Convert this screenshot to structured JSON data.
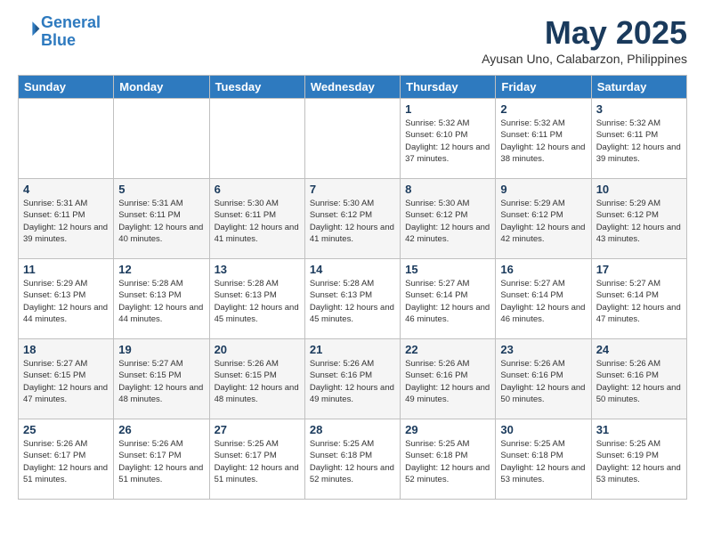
{
  "header": {
    "logo_line1": "General",
    "logo_line2": "Blue",
    "month": "May 2025",
    "location": "Ayusan Uno, Calabarzon, Philippines"
  },
  "days_of_week": [
    "Sunday",
    "Monday",
    "Tuesday",
    "Wednesday",
    "Thursday",
    "Friday",
    "Saturday"
  ],
  "weeks": [
    [
      {
        "day": "",
        "info": ""
      },
      {
        "day": "",
        "info": ""
      },
      {
        "day": "",
        "info": ""
      },
      {
        "day": "",
        "info": ""
      },
      {
        "day": "1",
        "info": "Sunrise: 5:32 AM\nSunset: 6:10 PM\nDaylight: 12 hours\nand 37 minutes."
      },
      {
        "day": "2",
        "info": "Sunrise: 5:32 AM\nSunset: 6:11 PM\nDaylight: 12 hours\nand 38 minutes."
      },
      {
        "day": "3",
        "info": "Sunrise: 5:32 AM\nSunset: 6:11 PM\nDaylight: 12 hours\nand 39 minutes."
      }
    ],
    [
      {
        "day": "4",
        "info": "Sunrise: 5:31 AM\nSunset: 6:11 PM\nDaylight: 12 hours\nand 39 minutes."
      },
      {
        "day": "5",
        "info": "Sunrise: 5:31 AM\nSunset: 6:11 PM\nDaylight: 12 hours\nand 40 minutes."
      },
      {
        "day": "6",
        "info": "Sunrise: 5:30 AM\nSunset: 6:11 PM\nDaylight: 12 hours\nand 41 minutes."
      },
      {
        "day": "7",
        "info": "Sunrise: 5:30 AM\nSunset: 6:12 PM\nDaylight: 12 hours\nand 41 minutes."
      },
      {
        "day": "8",
        "info": "Sunrise: 5:30 AM\nSunset: 6:12 PM\nDaylight: 12 hours\nand 42 minutes."
      },
      {
        "day": "9",
        "info": "Sunrise: 5:29 AM\nSunset: 6:12 PM\nDaylight: 12 hours\nand 42 minutes."
      },
      {
        "day": "10",
        "info": "Sunrise: 5:29 AM\nSunset: 6:12 PM\nDaylight: 12 hours\nand 43 minutes."
      }
    ],
    [
      {
        "day": "11",
        "info": "Sunrise: 5:29 AM\nSunset: 6:13 PM\nDaylight: 12 hours\nand 44 minutes."
      },
      {
        "day": "12",
        "info": "Sunrise: 5:28 AM\nSunset: 6:13 PM\nDaylight: 12 hours\nand 44 minutes."
      },
      {
        "day": "13",
        "info": "Sunrise: 5:28 AM\nSunset: 6:13 PM\nDaylight: 12 hours\nand 45 minutes."
      },
      {
        "day": "14",
        "info": "Sunrise: 5:28 AM\nSunset: 6:13 PM\nDaylight: 12 hours\nand 45 minutes."
      },
      {
        "day": "15",
        "info": "Sunrise: 5:27 AM\nSunset: 6:14 PM\nDaylight: 12 hours\nand 46 minutes."
      },
      {
        "day": "16",
        "info": "Sunrise: 5:27 AM\nSunset: 6:14 PM\nDaylight: 12 hours\nand 46 minutes."
      },
      {
        "day": "17",
        "info": "Sunrise: 5:27 AM\nSunset: 6:14 PM\nDaylight: 12 hours\nand 47 minutes."
      }
    ],
    [
      {
        "day": "18",
        "info": "Sunrise: 5:27 AM\nSunset: 6:15 PM\nDaylight: 12 hours\nand 47 minutes."
      },
      {
        "day": "19",
        "info": "Sunrise: 5:27 AM\nSunset: 6:15 PM\nDaylight: 12 hours\nand 48 minutes."
      },
      {
        "day": "20",
        "info": "Sunrise: 5:26 AM\nSunset: 6:15 PM\nDaylight: 12 hours\nand 48 minutes."
      },
      {
        "day": "21",
        "info": "Sunrise: 5:26 AM\nSunset: 6:16 PM\nDaylight: 12 hours\nand 49 minutes."
      },
      {
        "day": "22",
        "info": "Sunrise: 5:26 AM\nSunset: 6:16 PM\nDaylight: 12 hours\nand 49 minutes."
      },
      {
        "day": "23",
        "info": "Sunrise: 5:26 AM\nSunset: 6:16 PM\nDaylight: 12 hours\nand 50 minutes."
      },
      {
        "day": "24",
        "info": "Sunrise: 5:26 AM\nSunset: 6:16 PM\nDaylight: 12 hours\nand 50 minutes."
      }
    ],
    [
      {
        "day": "25",
        "info": "Sunrise: 5:26 AM\nSunset: 6:17 PM\nDaylight: 12 hours\nand 51 minutes."
      },
      {
        "day": "26",
        "info": "Sunrise: 5:26 AM\nSunset: 6:17 PM\nDaylight: 12 hours\nand 51 minutes."
      },
      {
        "day": "27",
        "info": "Sunrise: 5:25 AM\nSunset: 6:17 PM\nDaylight: 12 hours\nand 51 minutes."
      },
      {
        "day": "28",
        "info": "Sunrise: 5:25 AM\nSunset: 6:18 PM\nDaylight: 12 hours\nand 52 minutes."
      },
      {
        "day": "29",
        "info": "Sunrise: 5:25 AM\nSunset: 6:18 PM\nDaylight: 12 hours\nand 52 minutes."
      },
      {
        "day": "30",
        "info": "Sunrise: 5:25 AM\nSunset: 6:18 PM\nDaylight: 12 hours\nand 53 minutes."
      },
      {
        "day": "31",
        "info": "Sunrise: 5:25 AM\nSunset: 6:19 PM\nDaylight: 12 hours\nand 53 minutes."
      }
    ]
  ]
}
